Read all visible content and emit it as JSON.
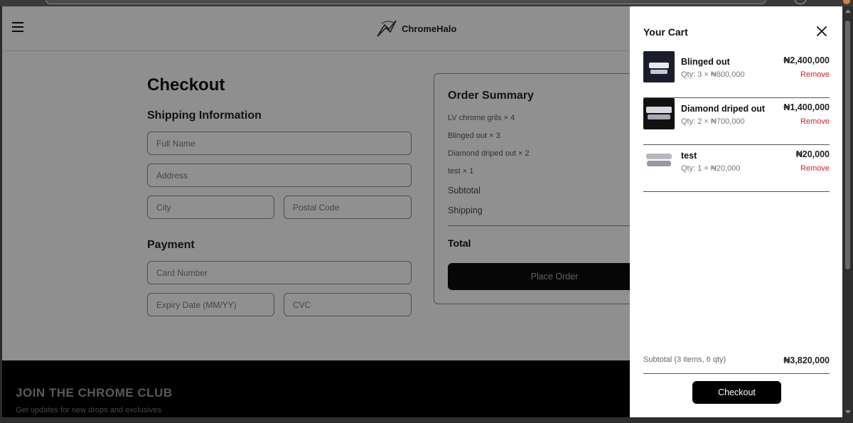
{
  "brand": {
    "name": "ChromeHalo"
  },
  "header": {
    "menu_icon": "hamburger-icon",
    "logo_icon": "chromehalo-logo-icon"
  },
  "checkout": {
    "title": "Checkout",
    "shipping_title": "Shipping Information",
    "payment_title": "Payment",
    "fields": {
      "full_name": {
        "placeholder": "Full Name"
      },
      "address": {
        "placeholder": "Address"
      },
      "city": {
        "placeholder": "City"
      },
      "postal_code": {
        "placeholder": "Postal Code"
      },
      "card_number": {
        "placeholder": "Card Number"
      },
      "expiry": {
        "placeholder": "Expiry Date (MM/YY)"
      },
      "cvc": {
        "placeholder": "CVC"
      }
    }
  },
  "order_summary": {
    "title": "Order Summary",
    "lines": [
      "LV chrome grils × 4",
      "Blinged out × 3",
      "Diamond driped out × 2",
      "test × 1"
    ],
    "subtotal_label": "Subtotal",
    "shipping_label": "Shipping",
    "total_label": "Total",
    "place_order_label": "Place Order"
  },
  "footer": {
    "title": "JOIN THE CHROME CLUB",
    "subtitle": "Get updates for new drops and exclusives"
  },
  "cart": {
    "title": "Your Cart",
    "close_icon": "close-icon",
    "items": [
      {
        "name": "Blinged out",
        "qty": "Qty: 3 × ₦800,000",
        "price": "₦2,400,000",
        "remove": "Remove"
      },
      {
        "name": "Diamond driped out",
        "qty": "Qty: 2 × ₦700,000",
        "price": "₦1,400,000",
        "remove": "Remove"
      },
      {
        "name": "test",
        "qty": "Qty: 1 × ₦20,000",
        "price": "₦20,000",
        "remove": "Remove"
      }
    ],
    "subtotal_label": "Subtotal (3 items, 6 qty)",
    "subtotal_value": "₦3,820,000",
    "checkout_label": "Checkout"
  },
  "colors": {
    "accent": "#000000",
    "remove": "#d2202a",
    "overlay": "rgba(0,0,0,0.42)"
  }
}
